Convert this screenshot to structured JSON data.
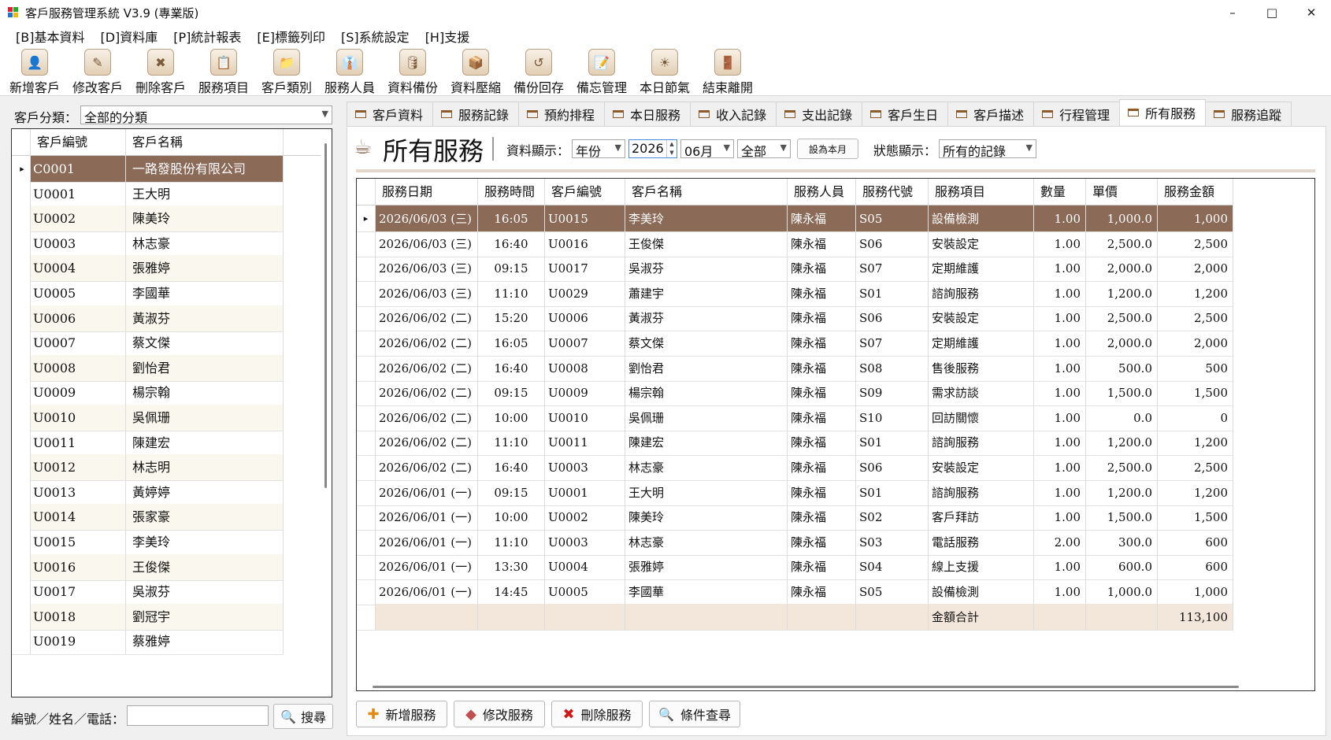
{
  "window": {
    "title": "客戶服務管理系統 V3.9 (專業版)",
    "minimize": "–",
    "maximize": "□",
    "close": "✕"
  },
  "menu": [
    "[B]基本資料",
    "[D]資料庫",
    "[P]統計報表",
    "[E]標籤列印",
    "[S]系統設定",
    "[H]支援"
  ],
  "toolbar": [
    {
      "label": "新增客戶",
      "icon": "add-customer-icon"
    },
    {
      "label": "修改客戶",
      "icon": "edit-customer-icon"
    },
    {
      "label": "刪除客戶",
      "icon": "delete-customer-icon"
    },
    {
      "label": "服務項目",
      "icon": "service-items-icon"
    },
    {
      "label": "客戶類別",
      "icon": "customer-category-icon"
    },
    {
      "label": "服務人員",
      "icon": "service-staff-icon"
    },
    {
      "label": "資料備份",
      "icon": "backup-icon"
    },
    {
      "label": "資料壓縮",
      "icon": "compress-icon"
    },
    {
      "label": "備份回存",
      "icon": "restore-icon"
    },
    {
      "label": "備忘管理",
      "icon": "memo-icon"
    },
    {
      "label": "本日節氣",
      "icon": "solar-term-icon"
    },
    {
      "label": "結束離開",
      "icon": "exit-icon"
    }
  ],
  "left": {
    "category_label": "客戶分類：",
    "category_value": "全部的分類",
    "columns": [
      "客戶編號",
      "客戶名稱"
    ],
    "rows": [
      [
        "C0001",
        "一路發股份有限公司"
      ],
      [
        "U0001",
        "王大明"
      ],
      [
        "U0002",
        "陳美玲"
      ],
      [
        "U0003",
        "林志豪"
      ],
      [
        "U0004",
        "張雅婷"
      ],
      [
        "U0005",
        "李國華"
      ],
      [
        "U0006",
        "黃淑芬"
      ],
      [
        "U0007",
        "蔡文傑"
      ],
      [
        "U0008",
        "劉怡君"
      ],
      [
        "U0009",
        "楊宗翰"
      ],
      [
        "U0010",
        "吳佩珊"
      ],
      [
        "U0011",
        "陳建宏"
      ],
      [
        "U0012",
        "林志明"
      ],
      [
        "U0013",
        "黃婷婷"
      ],
      [
        "U0014",
        "張家豪"
      ],
      [
        "U0015",
        "李美玲"
      ],
      [
        "U0016",
        "王俊傑"
      ],
      [
        "U0017",
        "吳淑芬"
      ],
      [
        "U0018",
        "劉冠宇"
      ],
      [
        "U0019",
        "蔡雅婷"
      ]
    ],
    "search_label": "編號／姓名／電話：",
    "search_value": "",
    "search_button": "搜尋"
  },
  "tabs": [
    "客戶資料",
    "服務記錄",
    "預約排程",
    "本日服務",
    "收入記錄",
    "支出記錄",
    "客戶生日",
    "客戶描述",
    "行程管理",
    "所有服務",
    "服務追蹤"
  ],
  "active_tab": 9,
  "panel": {
    "title": "所有服務",
    "display_label": "資料顯示：",
    "mode": "年份",
    "year": "2026",
    "month": "06月",
    "scope": "全部",
    "set_month_button": "設為本月",
    "status_label": "狀態顯示：",
    "status_value": "所有的記錄"
  },
  "grid": {
    "columns": [
      "服務日期",
      "服務時間",
      "客戶編號",
      "客戶名稱",
      "服務人員",
      "服務代號",
      "服務項目",
      "數量",
      "單價",
      "服務金額"
    ],
    "rows": [
      [
        "2026/06/03 (三)",
        "16:05",
        "U0015",
        "李美玲",
        "陳永福",
        "S05",
        "設備檢測",
        "1.00",
        "1,000.0",
        "1,000"
      ],
      [
        "2026/06/03 (三)",
        "16:40",
        "U0016",
        "王俊傑",
        "陳永福",
        "S06",
        "安裝設定",
        "1.00",
        "2,500.0",
        "2,500"
      ],
      [
        "2026/06/03 (三)",
        "09:15",
        "U0017",
        "吳淑芬",
        "陳永福",
        "S07",
        "定期維護",
        "1.00",
        "2,000.0",
        "2,000"
      ],
      [
        "2026/06/03 (三)",
        "11:10",
        "U0029",
        "蕭建宇",
        "陳永福",
        "S01",
        "諮詢服務",
        "1.00",
        "1,200.0",
        "1,200"
      ],
      [
        "2026/06/02 (二)",
        "15:20",
        "U0006",
        "黃淑芬",
        "陳永福",
        "S06",
        "安裝設定",
        "1.00",
        "2,500.0",
        "2,500"
      ],
      [
        "2026/06/02 (二)",
        "16:05",
        "U0007",
        "蔡文傑",
        "陳永福",
        "S07",
        "定期維護",
        "1.00",
        "2,000.0",
        "2,000"
      ],
      [
        "2026/06/02 (二)",
        "16:40",
        "U0008",
        "劉怡君",
        "陳永福",
        "S08",
        "售後服務",
        "1.00",
        "500.0",
        "500"
      ],
      [
        "2026/06/02 (二)",
        "09:15",
        "U0009",
        "楊宗翰",
        "陳永福",
        "S09",
        "需求訪談",
        "1.00",
        "1,500.0",
        "1,500"
      ],
      [
        "2026/06/02 (二)",
        "10:00",
        "U0010",
        "吳佩珊",
        "陳永福",
        "S10",
        "回訪關懷",
        "1.00",
        "0.0",
        "0"
      ],
      [
        "2026/06/02 (二)",
        "11:10",
        "U0011",
        "陳建宏",
        "陳永福",
        "S01",
        "諮詢服務",
        "1.00",
        "1,200.0",
        "1,200"
      ],
      [
        "2026/06/02 (二)",
        "16:40",
        "U0003",
        "林志豪",
        "陳永福",
        "S06",
        "安裝設定",
        "1.00",
        "2,500.0",
        "2,500"
      ],
      [
        "2026/06/01 (一)",
        "09:15",
        "U0001",
        "王大明",
        "陳永福",
        "S01",
        "諮詢服務",
        "1.00",
        "1,200.0",
        "1,200"
      ],
      [
        "2026/06/01 (一)",
        "10:00",
        "U0002",
        "陳美玲",
        "陳永福",
        "S02",
        "客戶拜訪",
        "1.00",
        "1,500.0",
        "1,500"
      ],
      [
        "2026/06/01 (一)",
        "11:10",
        "U0003",
        "林志豪",
        "陳永福",
        "S03",
        "電話服務",
        "2.00",
        "300.0",
        "600"
      ],
      [
        "2026/06/01 (一)",
        "13:30",
        "U0004",
        "張雅婷",
        "陳永福",
        "S04",
        "線上支援",
        "1.00",
        "600.0",
        "600"
      ],
      [
        "2026/06/01 (一)",
        "14:45",
        "U0005",
        "李國華",
        "陳永福",
        "S05",
        "設備檢測",
        "1.00",
        "1,000.0",
        "1,000"
      ]
    ],
    "total_label": "金額合計",
    "total_value": "113,100"
  },
  "buttons": {
    "add": "新增服務",
    "edit": "修改服務",
    "delete": "刪除服務",
    "query": "條件查尋"
  },
  "colors": {
    "selected_row": "#8b6a58",
    "alt_row": "#faf8ee",
    "total_row": "#f3e7dc"
  }
}
